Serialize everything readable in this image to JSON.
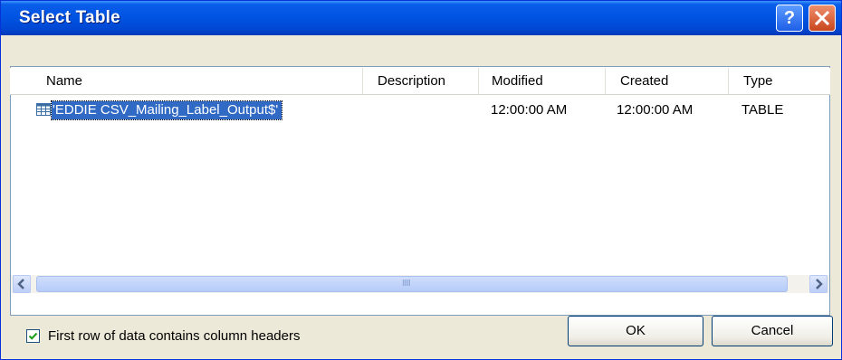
{
  "window": {
    "title": "Select Table"
  },
  "titlebar_buttons": {
    "help": "?",
    "close": "close"
  },
  "list": {
    "columns": [
      "Name",
      "Description",
      "Modified",
      "Created",
      "Type"
    ],
    "rows": [
      {
        "name": "'EDDIE CSV_Mailing_Label_Output$'",
        "description": "",
        "modified": "12:00:00 AM",
        "created": "12:00:00 AM",
        "type": "TABLE",
        "icon": "table-icon",
        "selected": true
      }
    ]
  },
  "scrollbar": {
    "thumb_grip": "IIIII"
  },
  "checkbox": {
    "label": "First row of data contains column headers",
    "checked": true
  },
  "buttons": {
    "ok": "OK",
    "cancel": "Cancel"
  },
  "colors": {
    "title_bar": "#0054e3",
    "selection": "#316ac5",
    "dialog_bg": "#ece9d8",
    "close_red": "#c8461e"
  }
}
